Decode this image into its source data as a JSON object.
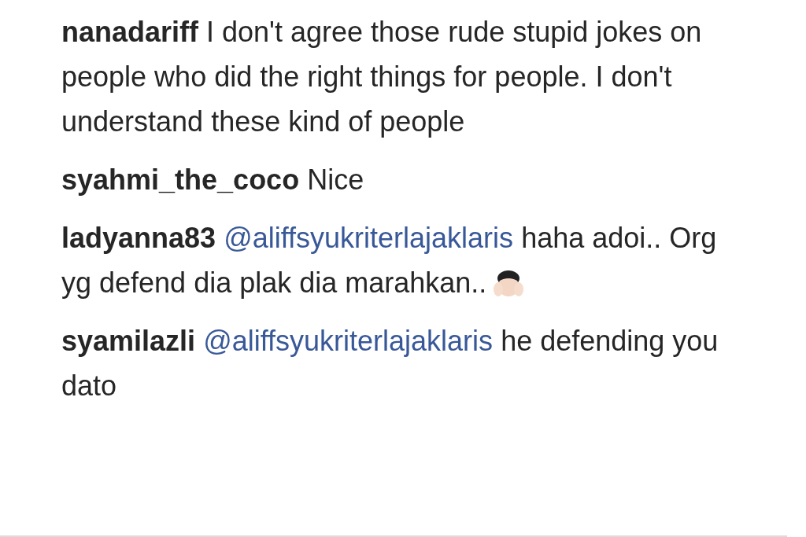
{
  "comments": [
    {
      "username": "nanadariff",
      "text": "I don't agree those rude stupid jokes on people who did the right things for people. I don't understand these kind of people"
    },
    {
      "username": "syahmi_the_coco",
      "text": "Nice"
    },
    {
      "username": "ladyanna83",
      "mention": "@aliffsyukriterlajaklaris",
      "text": "haha adoi.. Org yg defend dia plak dia marahkan..",
      "emoji": true
    },
    {
      "username": "syamilazli",
      "mention": "@aliffsyukriterlajaklaris",
      "text": "he defending you dato"
    }
  ]
}
